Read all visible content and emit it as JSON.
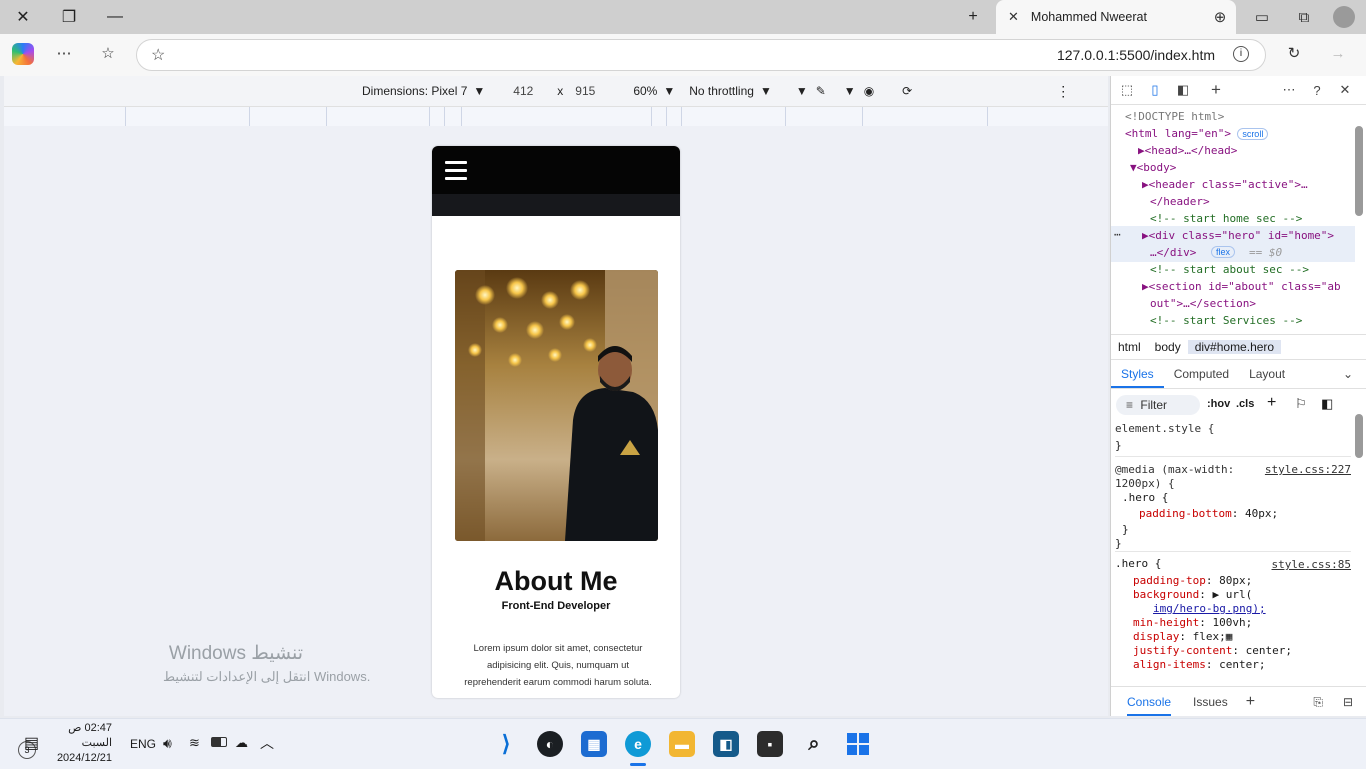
{
  "browser": {
    "tab_title": "Mohammed Nweerat",
    "url": "127.0.0.1:5500/index.htm",
    "new_tab_symbol": "+"
  },
  "emulation": {
    "dimensions_label": "Dimensions: Pixel 7",
    "width": "412",
    "times": "x",
    "height": "915",
    "zoom": "60%",
    "throttling": "No throttling"
  },
  "page": {
    "about_title": "About Me",
    "about_subtitle": "Front-End Developer",
    "about_text": "Lorem ipsum dolor sit amet, consectetur adipisicing elit. Quis, numquam ut reprehenderit earum commodi harum soluta."
  },
  "windows_activation": {
    "title": "Windows تنشيط",
    "subtitle": "انتقل إلى الإعدادات لتنشيط Windows."
  },
  "devtools": {
    "elements": [
      {
        "text": "<!DOCTYPE html>"
      },
      {
        "text": "<html lang=\"en\">",
        "badge": "scroll"
      },
      {
        "text": "▶<head>…</head>"
      },
      {
        "text": "▼<body>"
      },
      {
        "text": "▶<header class=\"active\">…"
      },
      {
        "text": "</header>"
      },
      {
        "text": "<!-- start home sec -->"
      },
      {
        "text": "▶<div class=\"hero\" id=\"home\">"
      },
      {
        "text": "…</div>",
        "badge": "flex",
        "suffix": "== $0"
      },
      {
        "text": "<!-- start about sec -->"
      },
      {
        "text": "▶<section id=\"about\" class=\"ab"
      },
      {
        "text": "out\">…</section>"
      },
      {
        "text": "<!-- start Services -->"
      }
    ],
    "breadcrumbs": [
      "html",
      "body",
      "div#home.hero"
    ],
    "style_tabs": [
      "Styles",
      "Computed",
      "Layout"
    ],
    "filter_placeholder": "Filter",
    "hov": ":hov",
    "cls": ".cls",
    "element_style": "element.style {",
    "element_style_close": "}",
    "media_rule": "@media (max-width:",
    "media_rule2": "1200px) {",
    "media_source": "style.css:227",
    "hero_sel_1": ".hero {",
    "padding_bottom_prop": "padding-bottom",
    "padding_bottom_val": "40px;",
    "close_inner": "}",
    "close_outer": "}",
    "hero_sel_2": ".hero {",
    "hero_source": "style.css:85",
    "hero_props": [
      {
        "prop": "padding-top",
        "val": "80px;"
      },
      {
        "prop": "background",
        "val": "▶ url("
      },
      {
        "prop": "",
        "val": "img/hero-bg.png);"
      },
      {
        "prop": "min-height",
        "val": "100vh;"
      },
      {
        "prop": "display",
        "val": "flex;"
      },
      {
        "prop": "justify-content",
        "val": "center;"
      },
      {
        "prop": "align-items",
        "val": "center;"
      }
    ],
    "bottom_tabs": [
      "Console",
      "Issues"
    ]
  },
  "taskbar": {
    "time": "02:47",
    "ampm": "ص",
    "day": "السبت",
    "date": "2024/12/21",
    "lang": "ENG",
    "notif_count": "3"
  }
}
